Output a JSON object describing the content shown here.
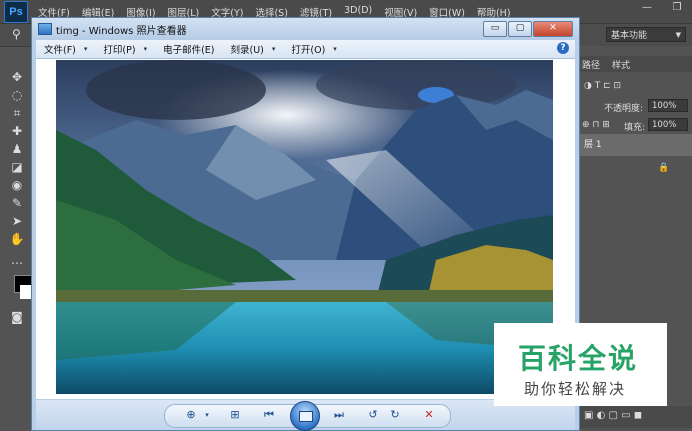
{
  "photoshop": {
    "logo": "Ps",
    "menu": [
      "文件(F)",
      "编辑(E)",
      "图像(I)",
      "图层(L)",
      "文字(Y)",
      "选择(S)",
      "滤镜(T)",
      "3D(D)",
      "视图(V)",
      "窗口(W)",
      "帮助(H)"
    ],
    "window_controls": {
      "minimize": "—",
      "restore": "❐"
    },
    "workspace_select": "基本功能",
    "panel": {
      "tabs": [
        "路径",
        "样式"
      ],
      "opacity_label": "不透明度:",
      "opacity_value": "100%",
      "fill_label": "填充:",
      "fill_value": "100%",
      "layer_name": "层 1"
    }
  },
  "viewer": {
    "title": "timg - Windows 照片查看器",
    "title_buttons": {
      "minimize": "▭",
      "maximize": "▢",
      "close": "✕"
    },
    "menu": [
      "文件(F)",
      "打印(P)",
      "电子邮件(E)",
      "刻录(U)",
      "打开(O)"
    ],
    "help": "?"
  },
  "watermark": {
    "title": "百科全说",
    "subtitle": "助你轻松解决"
  },
  "colors": {
    "ps_background": "#535353",
    "viewer_frame": "#b8cfe8",
    "watermark_green": "#27a367",
    "delete_red": "#c8281e"
  }
}
